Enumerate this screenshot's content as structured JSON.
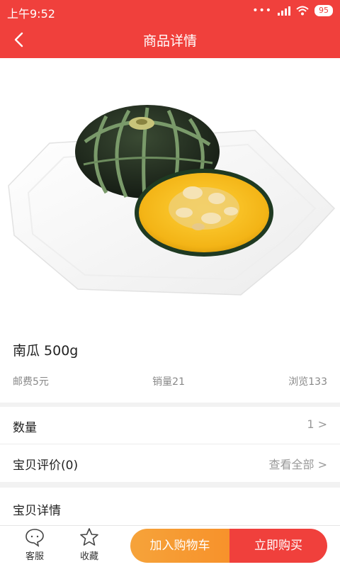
{
  "status_bar": {
    "time": "上午9:52",
    "battery": "95",
    "icons": [
      "more-dots-icon",
      "signal-icon",
      "wifi-icon",
      "battery-icon"
    ]
  },
  "nav": {
    "title": "商品详情",
    "back_icon": "chevron-left-icon"
  },
  "product": {
    "image_desc": "pumpkin-photo",
    "name": "南瓜 500g",
    "shipping": "邮费5元",
    "sales": "销量21",
    "views": "浏览133"
  },
  "rows": {
    "quantity_label": "数量",
    "quantity_value": "1 >",
    "reviews_label": "宝贝评价(0)",
    "reviews_value": "查看全部 >",
    "details_label": "宝贝详情"
  },
  "bottom_bar": {
    "service_label": "客服",
    "favorite_label": "收藏",
    "add_cart_label": "加入购物车",
    "buy_now_label": "立即购买"
  },
  "colors": {
    "brand_red": "#f0403c",
    "cart_orange": "#f7922b"
  }
}
